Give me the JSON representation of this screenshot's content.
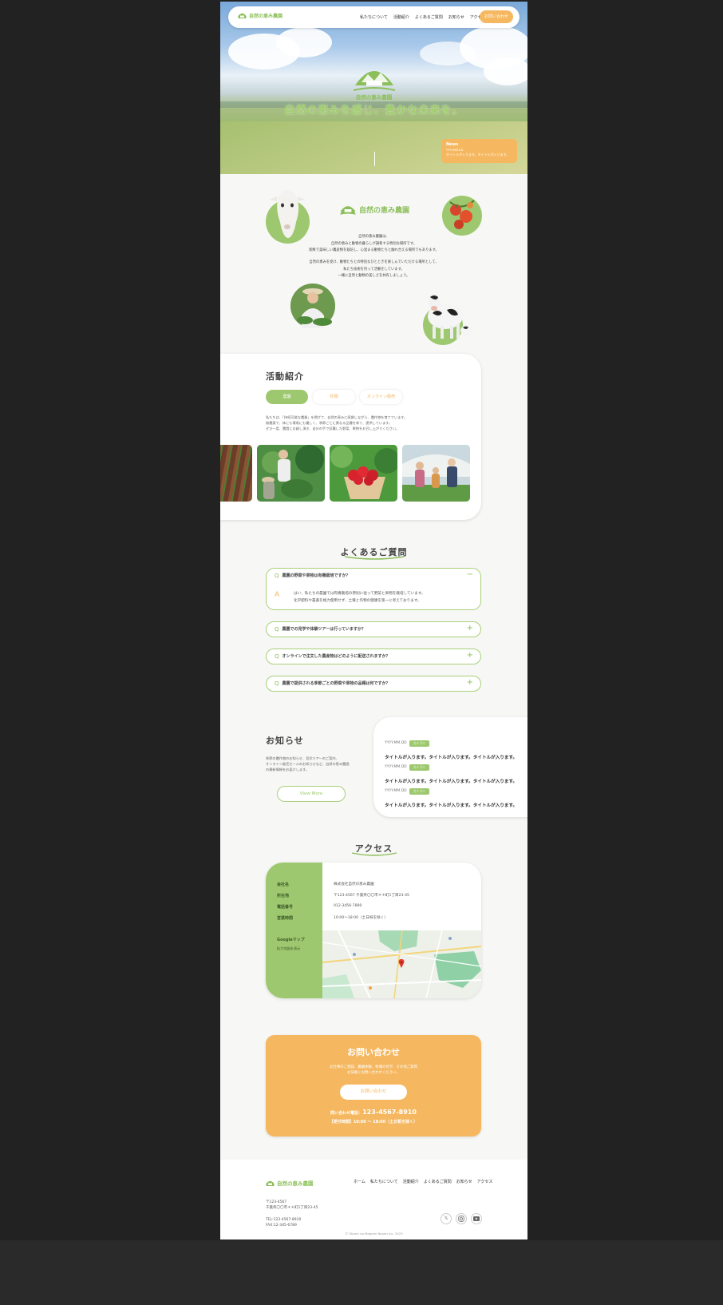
{
  "brand": {
    "name": "自然の恵み農園"
  },
  "nav": {
    "links": [
      "私たちについて",
      "活動紹介",
      "よくあるご質問",
      "お知らせ",
      "アクセス"
    ],
    "cta": "お問い合わせ"
  },
  "hero": {
    "brand": "自然の恵み農園",
    "copy": "自然の恵みを感じ、豊かな未来を。",
    "news": {
      "label": "News",
      "date": "YYYY.MM.DD",
      "title": "タイトルが入ります。タイトルが入ります。"
    }
  },
  "about": {
    "brand": "自然の恵み農園",
    "paragraph1": [
      "自然の恵み農園は、",
      "自然の恵みと動物の暮らしが調和する特別な場所です。",
      "新鮮で美味しい農産物を栽培し、心温まる動物たちと触れ合える場所でもあります。"
    ],
    "paragraph2": [
      "自然の恵みを受け、動物たちとの特別なひとときを楽しんでいただける場所として、",
      "私たち技術を持って活動をしています。",
      "一緒に自然と動物の美しさを共有しましょう。"
    ]
  },
  "activities": {
    "title": "活動紹介",
    "tabs": [
      "農園",
      "牧場",
      "オンライン販売"
    ],
    "description": [
      "私たちは、「持続可能な農業」を掲げて、自然の恵みに感謝しながら、農作物を育てています。",
      "無農薬で、体にも環境にも優しく、季節ごとに異なる品種を育て、提供しています。",
      "ぜひ一度、農園にお越し頂き、自分の手で収穫した野菜、果物をお召し上がりください。"
    ]
  },
  "faq": {
    "title": "よくあるご質問",
    "q_letter": "Q",
    "a_letter": "A",
    "items": [
      {
        "question": "農園の野菜や果物は有機栽培ですか？",
        "answer": [
          "はい、私たちの農園では有機栽培の原則に従って野菜と果物を栽培しています。",
          "化学肥料や農薬を極力使用せず、土壌と作物の健康を第一に考えております。"
        ],
        "open": true,
        "sign": "−"
      },
      {
        "question": "農園での見学や体験ツアーは行っていますか？",
        "open": false,
        "sign": "+"
      },
      {
        "question": "オンラインで注文した農産物はどのように配送されますか？",
        "open": false,
        "sign": "+"
      },
      {
        "question": "農園で提供される季節ごとの野菜や果物の品種は何ですか？",
        "open": false,
        "sign": "+"
      }
    ]
  },
  "news": {
    "title": "お知らせ",
    "description": [
      "季節の農作物のお知らせ、見学ツアーのご案内、",
      "オンライン販売セールのお知らせなど、自然の恵み農園",
      "の最新情報をお届けします。"
    ],
    "more": "View More",
    "items": [
      {
        "date": "YYYY.MM.DD",
        "category": "カテゴリ",
        "title": "タイトルが入ります。タイトルが入ります。タイトルが入ります。"
      },
      {
        "date": "YYYY.MM.DD",
        "category": "カテゴリ",
        "title": "タイトルが入ります。タイトルが入ります。タイトルが入ります。"
      },
      {
        "date": "YYYY.MM.DD",
        "category": "カテゴリ",
        "title": "タイトルが入ります。タイトルが入ります。タイトルが入ります。"
      }
    ]
  },
  "access": {
    "title": "アクセス",
    "rows": [
      {
        "label": "会社名",
        "value": "株式会社自然の恵み農園"
      },
      {
        "label": "所在地",
        "value": "〒123-4567 千葉県〇〇市＊＊町1丁目23-45"
      },
      {
        "label": "電話番号",
        "value": "012-3456-7890"
      },
      {
        "label": "営業時間",
        "value": "10:00～18:00（土日祝を除く）"
      }
    ],
    "map_label": "Googleマップ",
    "map_link": "拡大地図を表示"
  },
  "contact": {
    "title": "お問い合わせ",
    "description": [
      "お仕事のご相談、農園体験、牧場の見学、その他ご質問",
      "お気軽にお問い合わせください。"
    ],
    "button": "お問い合わせ",
    "tel_label": "問い合わせ電話：",
    "tel": "123-4567-8910",
    "hours": "【受付時間】10:00 ～ 18:00（土日祝を除く）"
  },
  "footer": {
    "brand": "自然の恵み農園",
    "links": [
      "ホーム",
      "私たちについて",
      "活動紹介",
      "よくあるご質問",
      "お知らせ",
      "アクセス"
    ],
    "address": [
      "〒123-4567",
      "千葉県〇〇市＊＊町1丁目23-45"
    ],
    "contact": [
      "TEL:123-4567-8910",
      "FAX:12-345-6789"
    ],
    "copyright": "© Shizen no Megumi Nouen Inc. 2023"
  },
  "colors": {
    "green": "#9dc86f",
    "orange": "#f5b75f",
    "page": "#f7f7f5",
    "background": "#222222"
  },
  "icons": [
    "farm-logo-icon",
    "x-icon",
    "instagram-icon",
    "youtube-icon",
    "map-pin-icon"
  ]
}
